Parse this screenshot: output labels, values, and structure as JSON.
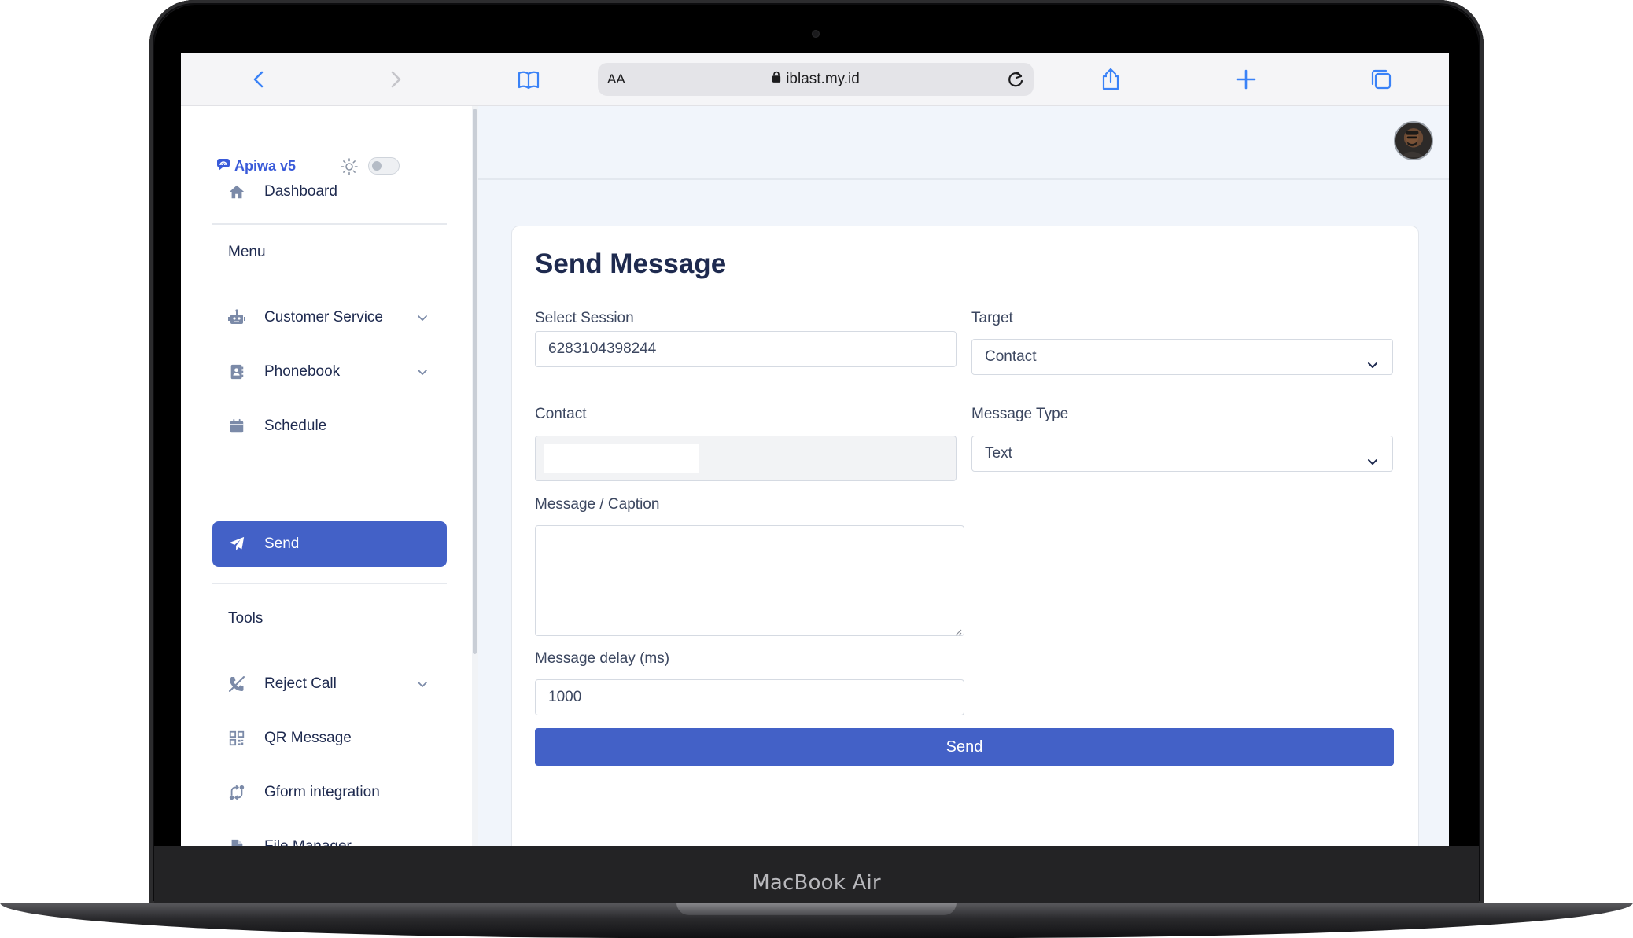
{
  "device": {
    "brand_label": "MacBook Air"
  },
  "browser": {
    "text_size_label": "AA",
    "url": "iblast.my.id",
    "icons": [
      "back-icon",
      "forward-icon",
      "bookmarks-icon",
      "lock-icon",
      "reload-icon",
      "share-icon",
      "new-tab-icon",
      "tabs-icon"
    ]
  },
  "app": {
    "logo": "Apiwa v5",
    "theme_toggle": "off"
  },
  "sidebar": {
    "dashboard": "Dashboard",
    "menu_heading": "Menu",
    "menu_items": [
      {
        "label": "Customer Service",
        "icon": "robot-icon",
        "expandable": true
      },
      {
        "label": "Phonebook",
        "icon": "contact-book-icon",
        "expandable": true
      },
      {
        "label": "Schedule",
        "icon": "calendar-icon",
        "expandable": false
      },
      {
        "label": "Send",
        "icon": "paper-plane-icon",
        "expandable": false,
        "active": true
      }
    ],
    "tools_heading": "Tools",
    "tool_items": [
      {
        "label": "Reject Call",
        "icon": "phone-off-icon",
        "expandable": true
      },
      {
        "label": "QR Message",
        "icon": "qr-code-icon",
        "expandable": false
      },
      {
        "label": "Gform integration",
        "icon": "sync-icon",
        "expandable": false
      },
      {
        "label": "File Manager",
        "icon": "file-icon",
        "expandable": false
      }
    ]
  },
  "form": {
    "title": "Send Message",
    "session_label": "Select Session",
    "session_value": "6283104398244",
    "target_label": "Target",
    "target_value": "Contact",
    "contact_label": "Contact",
    "contact_value": "",
    "message_type_label": "Message Type",
    "message_type_value": "Text",
    "message_label": "Message / Caption",
    "message_value": "",
    "delay_label": "Message delay (ms)",
    "delay_value": "1000",
    "submit_label": "Send"
  },
  "colors": {
    "accent": "#4361c7",
    "heading": "#1e2a4f",
    "browser_accent": "#3a82f7"
  }
}
